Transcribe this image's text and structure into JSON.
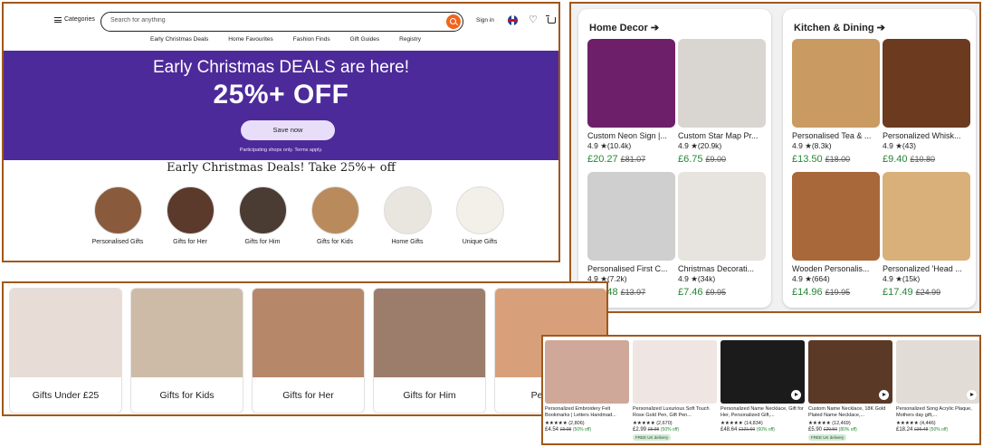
{
  "header": {
    "categories_label": "Categories",
    "search_placeholder": "Search for anything",
    "sign_in": "Sign in",
    "nav": [
      "Early Christmas Deals",
      "Home Favourites",
      "Fashion Finds",
      "Gift Guides",
      "Registry"
    ]
  },
  "banner": {
    "title": "Early Christmas DEALS are here!",
    "discount": "25%+ OFF",
    "button": "Save now",
    "fine_print": "Participating shops only. Terms apply."
  },
  "deals_section": {
    "title": "Early Christmas Deals! Take 25%+ off",
    "categories": [
      {
        "label": "Personalised Gifts",
        "color": "#8a5a3c"
      },
      {
        "label": "Gifts for Her",
        "color": "#5b3a2c"
      },
      {
        "label": "Gifts for Him",
        "color": "#4a3b33"
      },
      {
        "label": "Gifts for Kids",
        "color": "#b98a5c"
      },
      {
        "label": "Home Gifts",
        "color": "#e9e6df"
      },
      {
        "label": "Unique Gifts",
        "color": "#f3efe9"
      }
    ]
  },
  "home_decor": {
    "title": "Home Decor",
    "items": [
      {
        "name": "Custom Neon Sign |...",
        "rating": "4.9",
        "reviews": "(10.4k)",
        "price": "£20.27",
        "old_price": "£81.07",
        "color": "#6d1f6a"
      },
      {
        "name": "Custom Star Map Pr...",
        "rating": "4.9",
        "reviews": "(20.9k)",
        "price": "£6.75",
        "old_price": "£9.00",
        "color": "#d9d6d2"
      },
      {
        "name": "Personalised First C...",
        "rating": "4.9",
        "reviews": "(7.2k)",
        "price": "£10.48",
        "old_price": "£13.97",
        "color": "#cfcfcf"
      },
      {
        "name": "Christmas Decorati...",
        "rating": "4.9",
        "reviews": "(34k)",
        "price": "£7.46",
        "old_price": "£9.95",
        "color": "#e7e3de"
      }
    ]
  },
  "kitchen_dining": {
    "title": "Kitchen & Dining",
    "items": [
      {
        "name": "Personalised Tea & ...",
        "rating": "4.9",
        "reviews": "(8.3k)",
        "price": "£13.50",
        "old_price": "£18.00",
        "color": "#c99a62"
      },
      {
        "name": "Personalized Whisk...",
        "rating": "4.9",
        "reviews": "(43)",
        "price": "£9.40",
        "old_price": "£10.80",
        "color": "#6b3a1f"
      },
      {
        "name": "Wooden Personalis...",
        "rating": "4.9",
        "reviews": "(664)",
        "price": "£14.96",
        "old_price": "£19.95",
        "color": "#a8683a"
      },
      {
        "name": "Personalized 'Head ...",
        "rating": "4.9",
        "reviews": "(15k)",
        "price": "£17.49",
        "old_price": "£24.99",
        "color": "#d9b07a"
      }
    ]
  },
  "gift_categories": [
    {
      "label": "Gifts Under £25",
      "color": "#e8dcd6"
    },
    {
      "label": "Gifts for Kids",
      "color": "#cdbba7"
    },
    {
      "label": "Gifts for Her",
      "color": "#b7876a"
    },
    {
      "label": "Gifts for Him",
      "color": "#9c7d6b"
    },
    {
      "label": "Personali",
      "color": "#d8a07a"
    }
  ],
  "products": [
    {
      "name": "Personalized Embroidery Felt Bookmarks | Letters Handmad...",
      "stars": "★★★★★",
      "reviews": "(2,806)",
      "price": "£4.54",
      "old_price": "£9.08",
      "off": "(50% off)",
      "badge": "",
      "play": false,
      "color": "#cfa899"
    },
    {
      "name": "Personalized Luxurious Soft Touch Rose Gold Pen, Gift Pen...",
      "stars": "★★★★★",
      "reviews": "(2,670)",
      "price": "£2.99",
      "old_price": "£5.98",
      "off": "(50% off)",
      "badge": "FREE UK delivery",
      "play": false,
      "color": "#efe6e3"
    },
    {
      "name": "Personalized Name Necklace, Gift for Her, Personalized Gift,...",
      "stars": "★★★★★",
      "reviews": "(14,834)",
      "price": "£48.64",
      "old_price": "£121.60",
      "off": "(60% off)",
      "badge": "",
      "play": true,
      "color": "#1b1b1b"
    },
    {
      "name": "Custom Name Necklace, 18K Gold Plated Name Necklace,...",
      "stars": "★★★★★",
      "reviews": "(12,469)",
      "price": "£5.90",
      "old_price": "£29.50",
      "off": "(80% off)",
      "badge": "FREE UK delivery",
      "play": true,
      "color": "#5a3a26"
    },
    {
      "name": "Personalized Song Acrylic Plaque, Mothers day gift,...",
      "stars": "★★★★★",
      "reviews": "(4,446)",
      "price": "£18.24",
      "old_price": "£36.48",
      "off": "(50% off)",
      "badge": "",
      "play": true,
      "color": "#e2dcd6"
    }
  ]
}
